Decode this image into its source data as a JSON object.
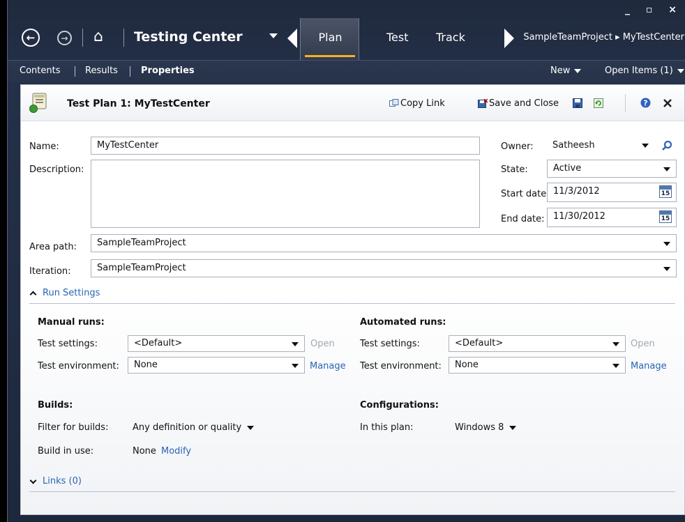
{
  "window_controls": "_ ▫ ×",
  "nav": {
    "app_title": "Testing Center",
    "tabs": [
      "Plan",
      "Test",
      "Track"
    ],
    "active_tab": "Plan",
    "project_breadcrumb": "SampleTeamProject ▸ MyTestCenter"
  },
  "subnav": {
    "items": [
      "Contents",
      "Results",
      "Properties"
    ],
    "new_label": "New",
    "open_items_label": "Open Items (1)"
  },
  "header": {
    "title": "Test Plan 1: MyTestCenter",
    "copy_link": "Copy Link",
    "save_and_close": "Save and Close"
  },
  "form": {
    "name_label": "Name:",
    "name_value": "MyTestCenter",
    "description_label": "Description:",
    "description_value": "",
    "owner_label": "Owner:",
    "owner_value": "Satheesh",
    "state_label": "State:",
    "state_value": "Active",
    "start_label": "Start date:",
    "start_value": "11/3/2012",
    "end_label": "End date:",
    "end_value": "11/30/2012",
    "calendar_day": "15",
    "area_label": "Area path:",
    "area_value": "SampleTeamProject",
    "iteration_label": "Iteration:",
    "iteration_value": "SampleTeamProject"
  },
  "run_settings": {
    "heading": "Run Settings",
    "manual": {
      "heading": "Manual runs:",
      "settings_label": "Test settings:",
      "settings_value": "<Default>",
      "open_label": "Open",
      "env_label": "Test environment:",
      "env_value": "None",
      "manage_label": "Manage"
    },
    "automated": {
      "heading": "Automated runs:",
      "settings_label": "Test settings:",
      "settings_value": "<Default>",
      "open_label": "Open",
      "env_label": "Test environment:",
      "env_value": "None",
      "manage_label": "Manage"
    },
    "builds": {
      "heading": "Builds:",
      "filter_label": "Filter for builds:",
      "filter_value": "Any definition or quality",
      "in_use_label": "Build in use:",
      "in_use_value": "None",
      "modify_label": "Modify"
    },
    "configurations": {
      "heading": "Configurations:",
      "in_plan_label": "In this plan:",
      "in_plan_value": "Windows 8"
    }
  },
  "links": {
    "heading": "Links (0)"
  }
}
